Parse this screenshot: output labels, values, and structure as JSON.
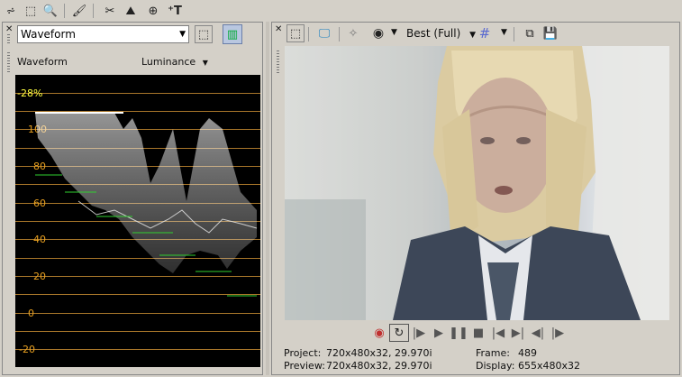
{
  "top_toolbar": {
    "icons": [
      "envelope-tool-icon",
      "selection-tool-icon",
      "zoom-tool-icon",
      "paint-brush-icon",
      "split-trim-icon",
      "render-icon",
      "preview-zoom-icon",
      "text-tool-icon"
    ]
  },
  "scopes": {
    "selector_value": "Waveform",
    "view_label": "Waveform",
    "mode_value": "Luminance",
    "overlay_percent": "-28%",
    "y_labels": [
      "100",
      "80",
      "60",
      "40",
      "20",
      "0",
      "-20"
    ],
    "colors": {
      "grid": "#a8762a",
      "label": "#e8a020",
      "overlay": "#ffff40"
    }
  },
  "preview": {
    "quality_value": "Best (Full)",
    "transport": [
      "record-icon",
      "loop-icon",
      "play-from-start-icon",
      "play-icon",
      "pause-icon",
      "stop-icon",
      "go-to-start-icon",
      "go-to-end-icon",
      "previous-frame-icon",
      "next-frame-icon"
    ],
    "info": {
      "project_label": "Project:",
      "project_value": "720x480x32, 29.970i",
      "preview_label": "Preview:",
      "preview_value": "720x480x32, 29.970i",
      "frame_label": "Frame:",
      "frame_value": "489",
      "display_label": "Display:",
      "display_value": "655x480x32"
    }
  }
}
